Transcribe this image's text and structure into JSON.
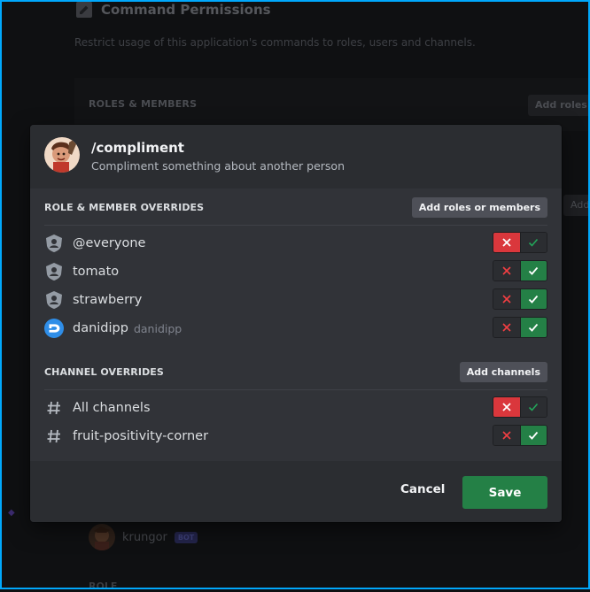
{
  "background": {
    "title": "Command Permissions",
    "description": "Restrict usage of this application's commands to roles, users and channels.",
    "section_label": "ROLES & MEMBERS",
    "add_button": "Add roles or members",
    "add_button_2": "Add",
    "bot_name": "krungor",
    "bot_tag": "BOT",
    "role_label": "ROLE"
  },
  "modal": {
    "command_name": "/compliment",
    "command_description": "Compliment something about another person",
    "role_section": {
      "label": "ROLE & MEMBER OVERRIDES",
      "add_button": "Add roles or members",
      "items": [
        {
          "label": "@everyone",
          "sub": "",
          "icon": "role-shield-icon",
          "state": "deny"
        },
        {
          "label": "tomato",
          "sub": "",
          "icon": "role-shield-icon",
          "state": "allow"
        },
        {
          "label": "strawberry",
          "sub": "",
          "icon": "role-shield-icon",
          "state": "allow"
        },
        {
          "label": "danidipp",
          "sub": "danidipp",
          "icon": "user-avatar",
          "state": "allow"
        }
      ]
    },
    "channel_section": {
      "label": "CHANNEL OVERRIDES",
      "add_button": "Add channels",
      "items": [
        {
          "label": "All channels",
          "icon": "hash-icon",
          "state": "deny"
        },
        {
          "label": "fruit-positivity-corner",
          "icon": "hash-icon",
          "state": "allow"
        }
      ]
    },
    "footer": {
      "cancel_label": "Cancel",
      "save_label": "Save"
    }
  },
  "colors": {
    "deny": "#da373c",
    "allow": "#248046",
    "accent_border": "#00a8fc"
  }
}
